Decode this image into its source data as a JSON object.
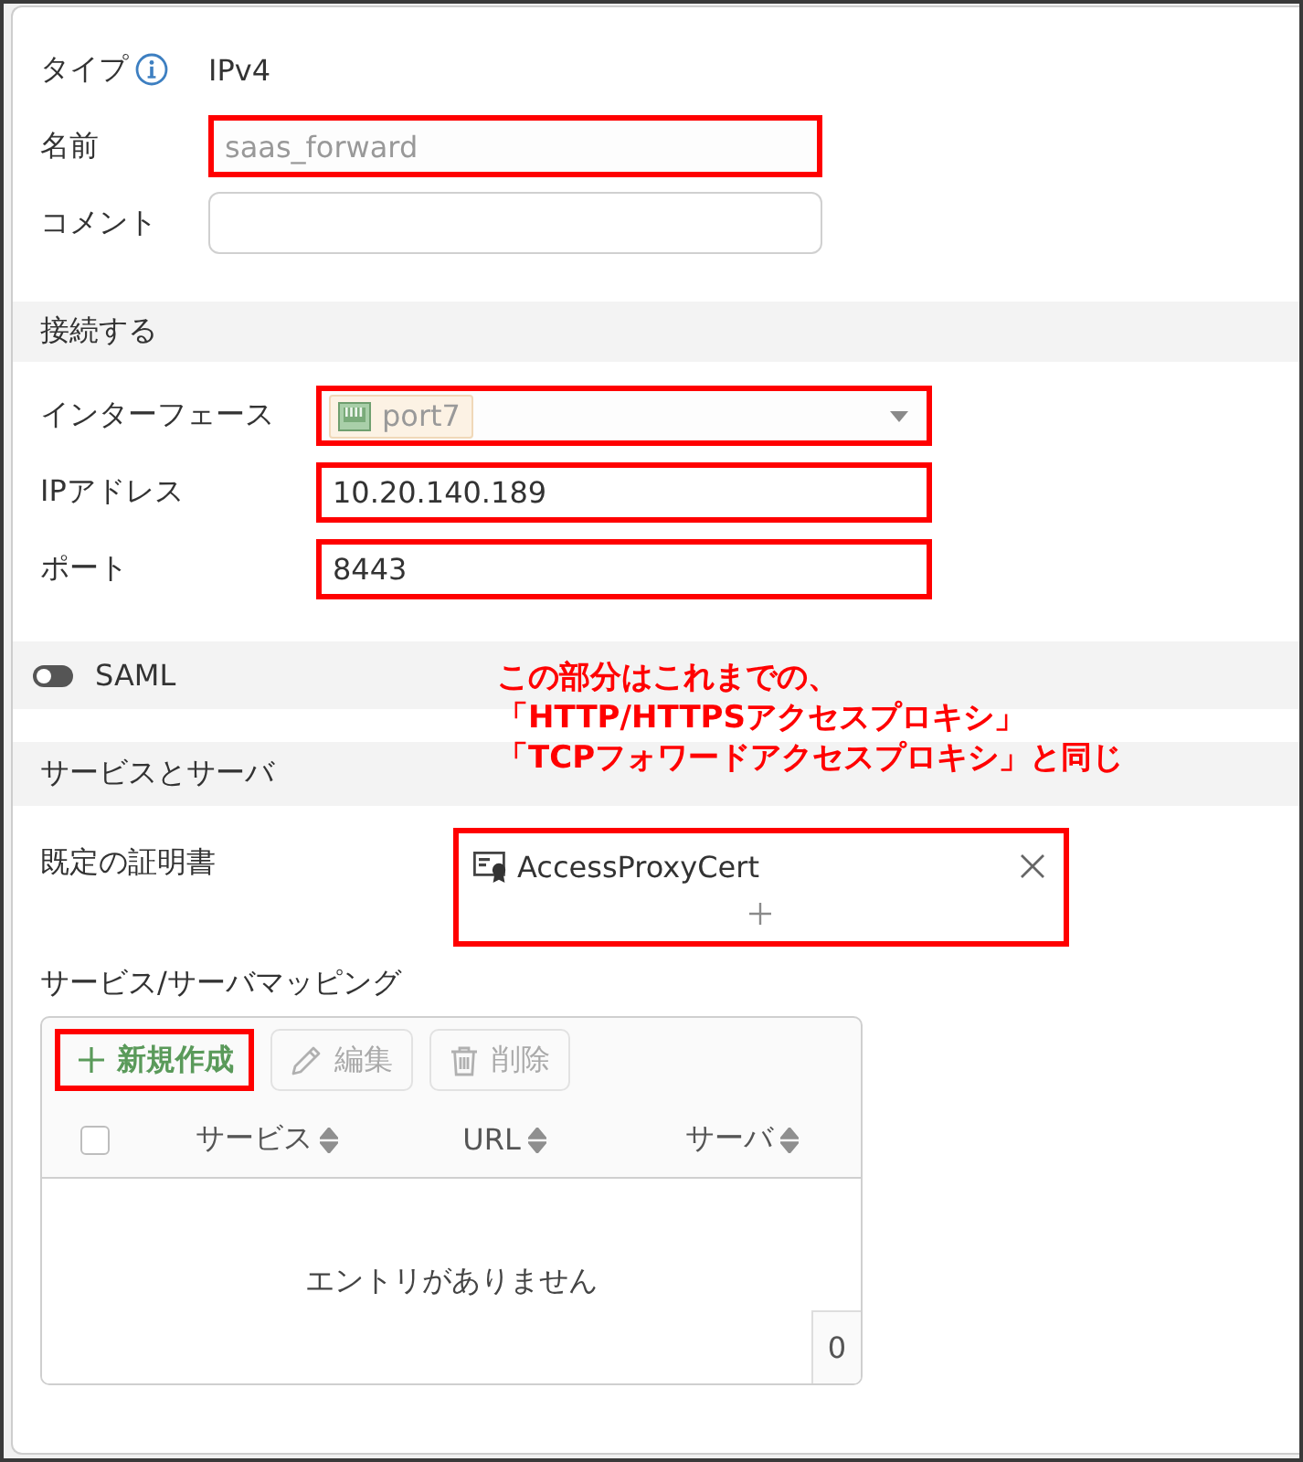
{
  "general": {
    "rows": [
      {
        "kind": "info",
        "label": "タイプ",
        "value": "IPv4"
      },
      {
        "kind": "text",
        "label": "名前",
        "value": "saas_forward",
        "disabled": true,
        "highlighted": true
      },
      {
        "kind": "text",
        "label": "コメント",
        "highlighted": false
      }
    ]
  },
  "connection": {
    "title": "接続する",
    "rows": [
      {
        "kind": "select",
        "label": "インターフェース",
        "value": "port7",
        "disabled": true,
        "highlighted": true
      },
      {
        "kind": "text",
        "label": "IPアドレス",
        "value": "10.20.140.189",
        "disabled": false,
        "highlighted": true
      },
      {
        "kind": "text",
        "label": "ポート",
        "value": "8443",
        "disabled": false,
        "highlighted": true
      }
    ]
  },
  "saml": {
    "label": "SAML",
    "on": false
  },
  "annotation": {
    "lines": [
      "この部分はこれまでの、",
      "「HTTP/HTTPSアクセスプロキシ」",
      "「TCPフォワードアクセスプロキシ」と同じ"
    ]
  },
  "services": {
    "title": "サービスとサーバ",
    "certificate": {
      "label": "既定の証明書",
      "items": [
        "AccessProxyCert"
      ],
      "highlighted": true
    },
    "mapping": {
      "label": "サービス/サーバマッピング",
      "toolbar": [
        {
          "kind": "create",
          "label": "新規作成",
          "disabled": false,
          "highlighted": true
        },
        {
          "kind": "edit",
          "label": "編集",
          "disabled": true,
          "highlighted": false
        },
        {
          "kind": "delete",
          "label": "削除",
          "disabled": true,
          "highlighted": false
        }
      ],
      "select_all_checked": false,
      "columns": [
        "サービス",
        "URL",
        "サーバ"
      ],
      "empty_text": "エントリがありません",
      "count": "0"
    }
  }
}
